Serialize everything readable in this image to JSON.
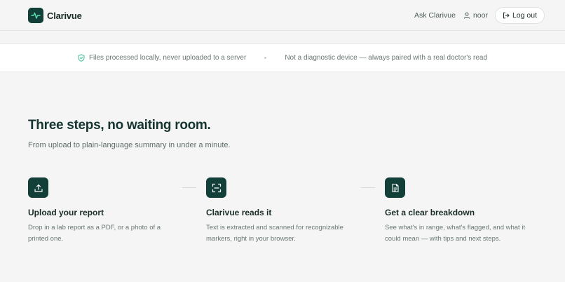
{
  "header": {
    "brand": "Clarivue",
    "ask_link": "Ask Clarivue",
    "username": "noor",
    "logout_label": "Log out"
  },
  "trust": {
    "item1": "Files processed locally, never uploaded to a server",
    "item2": "Not a diagnostic device — always paired with a real doctor's read"
  },
  "section": {
    "title": "Three steps, no waiting room.",
    "subtitle": "From upload to plain-language summary in under a minute."
  },
  "steps": [
    {
      "icon": "upload-icon",
      "title": "Upload your report",
      "description": "Drop in a lab report as a PDF, or a photo of a printed one."
    },
    {
      "icon": "scan-icon",
      "title": "Clarivue reads it",
      "description": "Text is extracted and scanned for recognizable markers, right in your browser."
    },
    {
      "icon": "document-icon",
      "title": "Get a clear breakdown",
      "description": "See what's in range, what's flagged, and what it could mean — with tips and next steps."
    }
  ],
  "colors": {
    "brand": "#123f38",
    "accent": "#2fbf8f",
    "background": "#f4f5f4"
  }
}
